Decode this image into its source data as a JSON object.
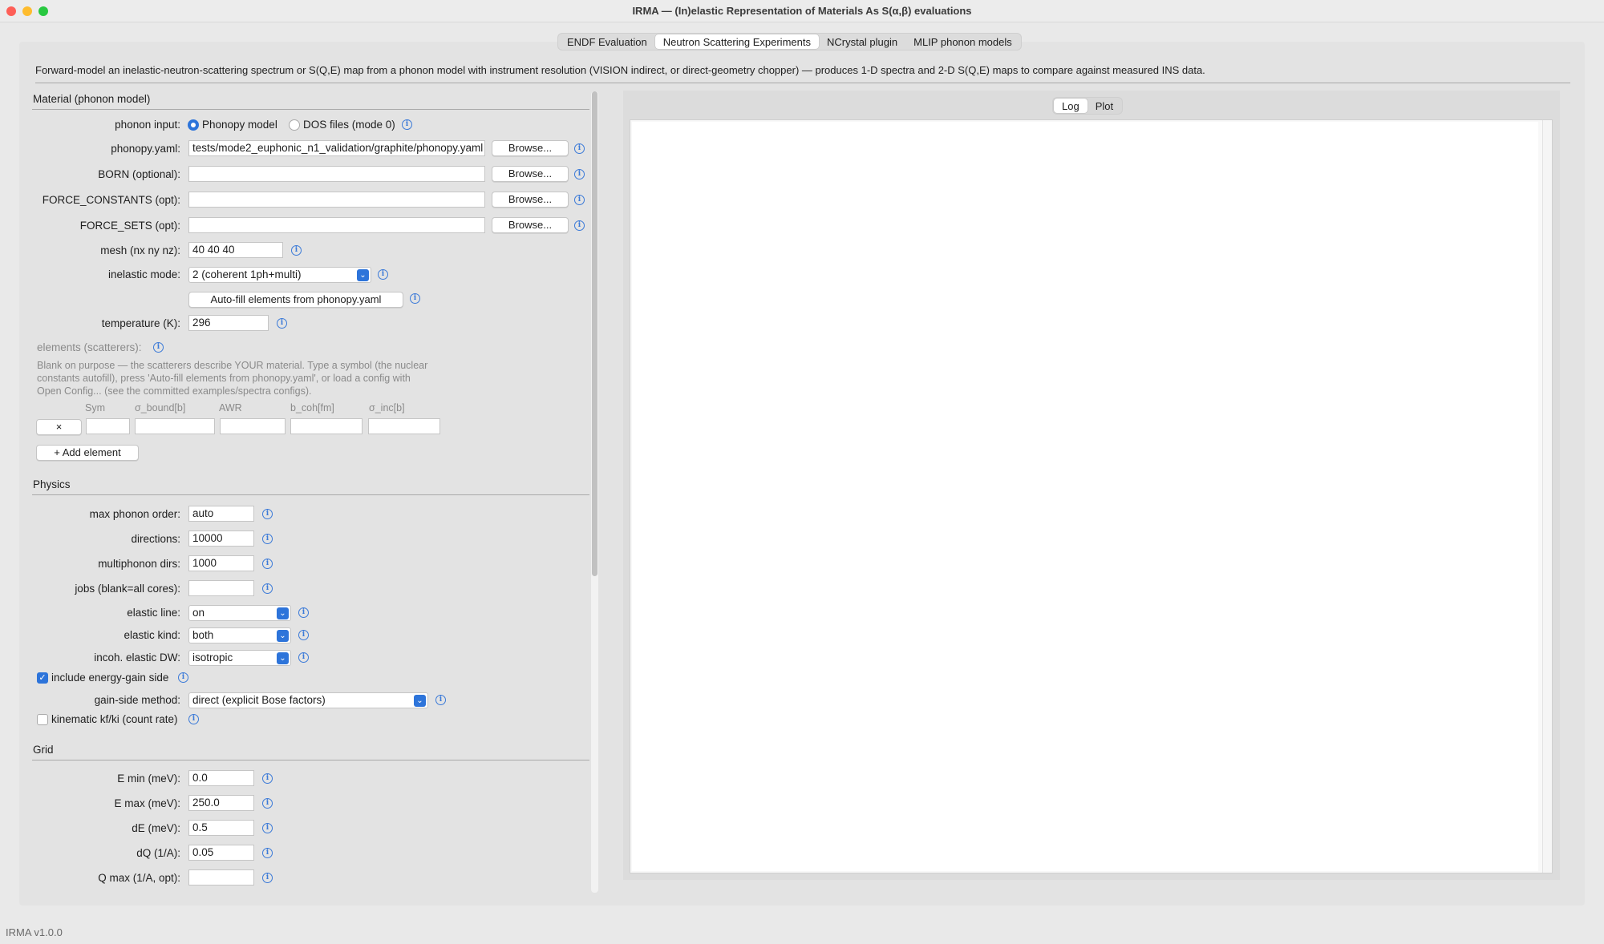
{
  "window": {
    "title": "IRMA — (In)elastic Representation of Materials As S(α,β) evaluations",
    "status": "IRMA v1.0.0"
  },
  "tabs": [
    "ENDF Evaluation",
    "Neutron Scattering Experiments",
    "NCrystal plugin",
    "MLIP phonon models"
  ],
  "description": "Forward-model an inelastic-neutron-scattering spectrum or S(Q,E) map from a phonon model with instrument resolution (VISION indirect, or direct-geometry chopper) — produces 1-D spectra and 2-D S(Q,E) maps to compare against measured INS data.",
  "material": {
    "title": "Material (phonon model)",
    "phonon_input_label": "phonon input:",
    "radio_phonopy": "Phonopy model",
    "radio_dos": "DOS files (mode 0)",
    "phonopy_label": "phonopy.yaml:",
    "phonopy_value": "tests/mode2_euphonic_n1_validation/graphite/phonopy.yaml",
    "born_label": "BORN (optional):",
    "fc_label": "FORCE_CONSTANTS (opt):",
    "fs_label": "FORCE_SETS (opt):",
    "browse": "Browse...",
    "mesh_label": "mesh (nx ny nz):",
    "mesh_value": "40 40 40",
    "mode_label": "inelastic mode:",
    "mode_value": "2 (coherent 1ph+multi)",
    "autofill": "Auto-fill elements from phonopy.yaml",
    "temp_label": "temperature (K):",
    "temp_value": "296",
    "elements_label": "elements (scatterers):",
    "elements_help": [
      "Blank on purpose — the scatterers describe YOUR material. Type a symbol (the nuclear",
      "constants autofill), press 'Auto-fill elements from phonopy.yaml', or load a config with",
      "Open Config... (see the committed examples/spectra configs)."
    ],
    "col_headers": [
      "Sym",
      "σ_bound[b]",
      "AWR",
      "b_coh[fm]",
      "σ_inc[b]"
    ],
    "remove": "×",
    "add_element": "+ Add element"
  },
  "physics": {
    "title": "Physics",
    "max_order_label": "max phonon order:",
    "max_order_value": "auto",
    "directions_label": "directions:",
    "directions_value": "10000",
    "multi_label": "multiphonon dirs:",
    "multi_value": "1000",
    "jobs_label": "jobs (blank=all cores):",
    "elastic_line_label": "elastic line:",
    "elastic_line_value": "on",
    "elastic_kind_label": "elastic kind:",
    "elastic_kind_value": "both",
    "incoh_label": "incoh. elastic DW:",
    "incoh_value": "isotropic",
    "gain_label": "include energy-gain side",
    "gain_method_label": "gain-side method:",
    "gain_method_value": "direct (explicit Bose factors)",
    "kinematic_label": "kinematic kf/ki (count rate)"
  },
  "grid": {
    "title": "Grid",
    "emin_label": "E min (meV):",
    "emin_value": "0.0",
    "emax_label": "E max (meV):",
    "emax_value": "250.0",
    "de_label": "dE (meV):",
    "de_value": "0.5",
    "dq_label": "dQ (1/A):",
    "dq_value": "0.05",
    "qmax_label": "Q max (1/A, opt):"
  },
  "output_tabs": [
    "Log",
    "Plot"
  ],
  "colors": {
    "accent": "#2d74da",
    "info": "#3b7ad8"
  }
}
